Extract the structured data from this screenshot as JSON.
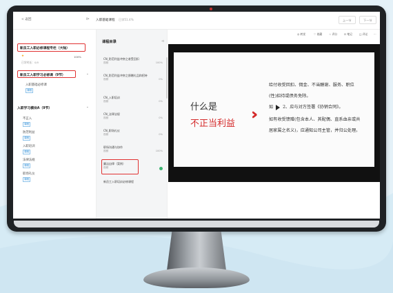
{
  "topbar": {
    "back_label": "< 返回",
    "course_title": "入职基础课程",
    "course_progress": "已学51.4%",
    "prev_label": "上一节",
    "next_label": "下一节"
  },
  "left_panel": {
    "program_title": "新员工入职必修课程专栏（大陆）",
    "progress_pct": "100%",
    "progress_fraction": 1.0,
    "study_time": "已学时长：0/0",
    "stage_title": "新员工入职学习必修课（9节）",
    "module_item": "入职基础必修课",
    "module_tag": "课程",
    "section_header": "入职学习模块A（9节）",
    "items": [
      {
        "label": "不正入",
        "tag": "课程"
      },
      {
        "label": "防范利益",
        "tag": "课程"
      },
      {
        "label": "入职培训",
        "tag": "课程"
      },
      {
        "label": "法律法规",
        "tag": "课程"
      },
      {
        "label": "职场礼仪",
        "tag": "课程"
      }
    ]
  },
  "chapters": {
    "header": "课程目录",
    "items": [
      {
        "title": "CN_防范利益冲突之收受回扣",
        "meta": "视频",
        "pct": "100%"
      },
      {
        "title": "CN_防范利益冲突之馈赠礼品和招待",
        "meta": "视频",
        "pct": "0%"
      },
      {
        "title": "CN_入职培训",
        "meta": "视频",
        "pct": "0%"
      },
      {
        "title": "CN_法律法规",
        "meta": "视频",
        "pct": "0%"
      },
      {
        "title": "CN_职场礼仪",
        "meta": "视频",
        "pct": "0%"
      },
      {
        "title": "职场沟通与协作",
        "meta": "视频",
        "pct": "100%"
      },
      {
        "title": "廉洁自律（案例）",
        "meta": "视频",
        "pct": ""
      },
      {
        "title": "新员工入职培训必修课程",
        "meta": "",
        "pct": ""
      }
    ]
  },
  "toolbar": {
    "items": [
      "◎ 转发",
      "♡ 收藏",
      "☆ 评分",
      "⊡ 笔记",
      "◫ 评论",
      "⋯"
    ]
  },
  "slide": {
    "left_top": "什么是",
    "left_bottom": "不正当利益",
    "lines": [
      "给付收受回扣、佣金、不当酬谢、服务、职位",
      "(性)招待或债务免除。",
      "如          应与对方签署《协销合同》。",
      "如有收受馈赠(包含本人、其配偶、直系血亲或共",
      "居家属之名义)，应通知公司主管，并归公处理。"
    ],
    "play_prefix": "如",
    "play_suffix": "2、应与对方签署《协销合同》。"
  },
  "colors": {
    "accent_red": "#d42a2a",
    "progress": "#f5a623",
    "done": "#3cb371"
  }
}
